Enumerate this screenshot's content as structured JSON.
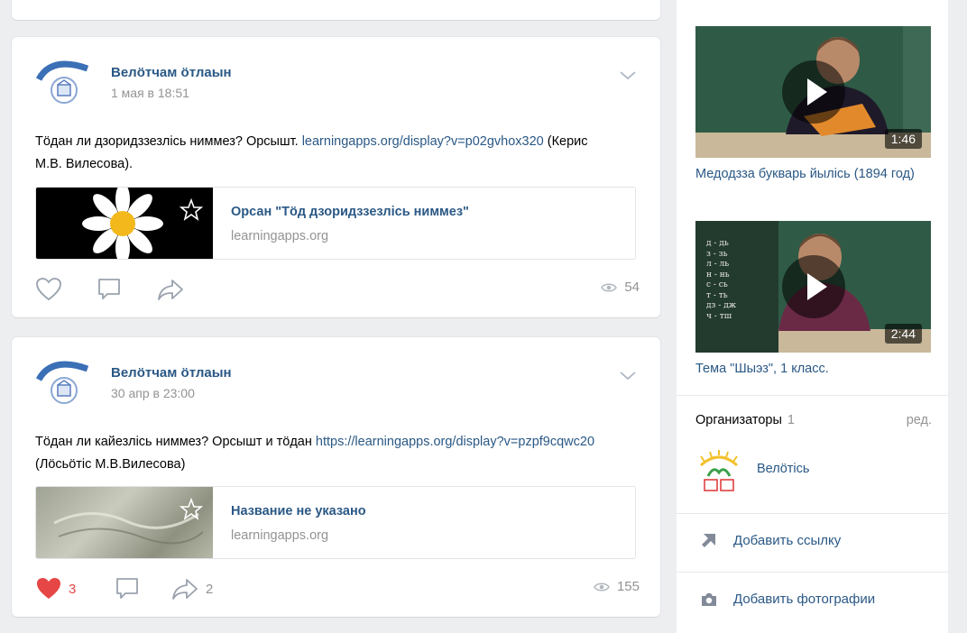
{
  "posts": [
    {
      "author": "Велӧтчам ӧтлаын",
      "date": "1 мая в 18:51",
      "text_before": "Тӧдан ли дзоридззезлісь ниммез? Орсышт. ",
      "link": "learningapps.org/display?v=p02gvhox320",
      "text_after": " (Керис М.В. Вилесова).",
      "attachment": {
        "title": "Орсан \"Тӧд дзоридззезлісь ниммез\"",
        "domain": "learningapps.org"
      },
      "likes": "",
      "comments": "",
      "shares": "",
      "views": "54",
      "liked": false
    },
    {
      "author": "Велӧтчам ӧтлаын",
      "date": "30 апр в 23:00",
      "text_before": "Тӧдан ли кайезлісь ниммез? Орсышт и тӧдан ",
      "link": "https://learningapps.org/display?v=pzpf9cqwc20",
      "text_after": " (Лӧсьӧтіс М.В.Вилесова)",
      "attachment": {
        "title": "Название не указано",
        "domain": "learningapps.org"
      },
      "likes": "3",
      "comments": "",
      "shares": "2",
      "views": "155",
      "liked": true
    }
  ],
  "sidebar": {
    "videos": [
      {
        "title": "Медодзза букварь йылісь (1894 год)",
        "duration": "1:46"
      },
      {
        "title": "Тема \"Шыэз\", 1 класс.",
        "duration": "2:44",
        "board_lines": [
          "д - дь",
          "з - зь",
          "л - ль",
          "н - нь",
          "с - сь",
          "т - ть",
          "дз - дж",
          "ч - тш"
        ]
      }
    ],
    "organizers_label": "Организаторы",
    "organizers_count": "1",
    "edit_label": "ред.",
    "organizer_name": "Велӧтісь",
    "add_link_label": "Добавить ссылку",
    "add_photo_label": "Добавить фотографии"
  },
  "colors": {
    "link": "#2a5885",
    "muted": "#939393",
    "like_red": "#e64646",
    "background": "#edeef0"
  }
}
